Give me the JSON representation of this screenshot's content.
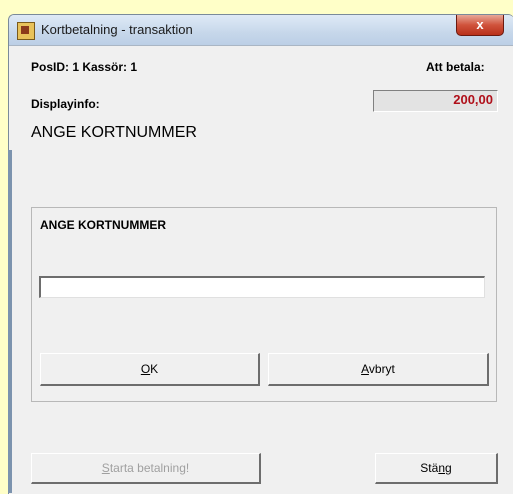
{
  "window": {
    "title": "Kortbetalning - transaktion",
    "close_label": "x"
  },
  "header": {
    "pos_info": "PosID: 1 Kassör: 1",
    "to_pay_label": "Att betala:",
    "amount": "200,00",
    "display_label": "Displayinfo:",
    "display_text": "ANGE KORTNUMMER"
  },
  "card_panel": {
    "title": "ANGE KORTNUMMER",
    "input_value": "",
    "ok": {
      "mnemonic": "O",
      "rest": "K"
    },
    "cancel": {
      "mnemonic": "A",
      "rest": "vbryt"
    }
  },
  "footer": {
    "start_payment": {
      "mnemonic": "S",
      "rest": "tarta betalning!"
    },
    "close": {
      "before": "Stä",
      "mnemonic": "n",
      "after": "g"
    }
  },
  "colors": {
    "amount_text": "#b0101a",
    "background": "#ffffc8"
  },
  "icons": {
    "app": "card-payment-app-icon",
    "close": "close-icon"
  }
}
